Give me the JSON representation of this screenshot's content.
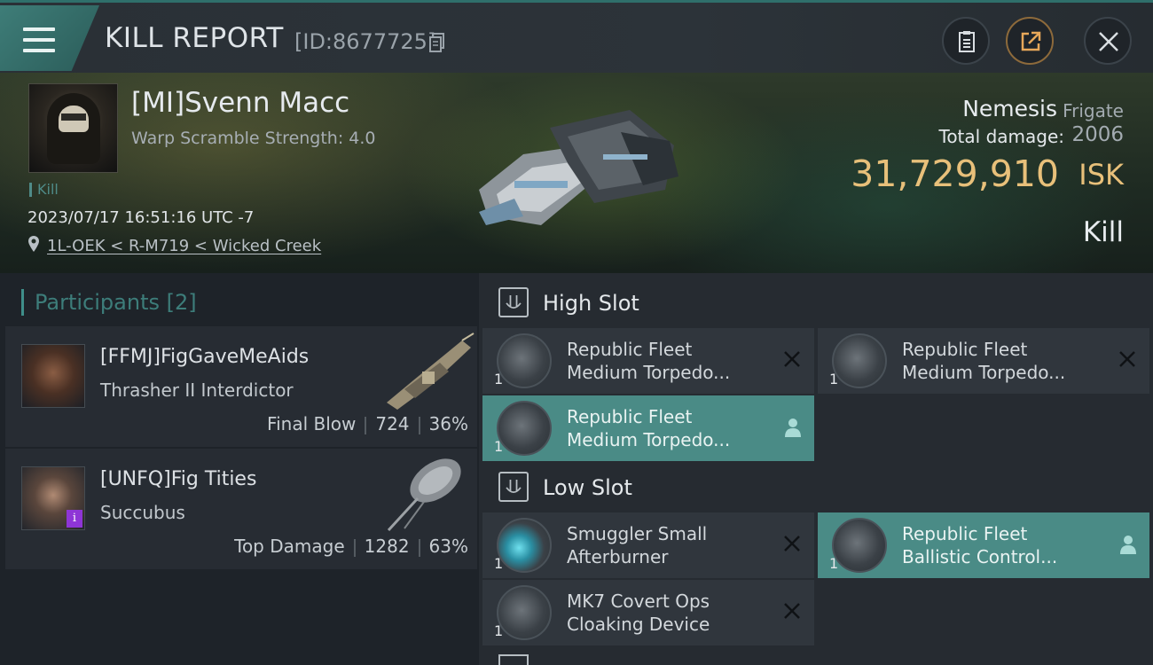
{
  "header": {
    "title": "KILL REPORT",
    "report_id": "[ID:8677725]"
  },
  "victim": {
    "name": "[MI]Svenn Macc",
    "warp_scramble": "Warp Scramble Strength: 4.0",
    "tag": "Kill",
    "datetime": "2023/07/17 16:51:16 UTC -7",
    "location": "1L-OEK < R-M719 < Wicked Creek"
  },
  "ship": {
    "name": "Nemesis",
    "class": "Frigate",
    "total_damage_label": "Total damage:",
    "total_damage": "2006",
    "isk_value": "31,729,910",
    "isk_unit": "ISK",
    "result": "Kill"
  },
  "participants": {
    "header": "Participants [2]",
    "items": [
      {
        "name": "[FFMJ]FigGaveMeAids",
        "ship": "Thrasher II Interdictor",
        "role": "Final Blow",
        "damage": "724",
        "percent": "36%"
      },
      {
        "name": "[UNFQ]Fig Tities",
        "ship": "Succubus",
        "role": "Top Damage",
        "damage": "1282",
        "percent": "63%",
        "badge": "i"
      }
    ]
  },
  "fitting": {
    "high_slot": {
      "title": "High Slot",
      "modules": [
        {
          "line1": "Republic Fleet",
          "line2": "Medium Torpedo...",
          "qty": "1",
          "state": "destroyed"
        },
        {
          "line1": "Republic Fleet",
          "line2": "Medium Torpedo...",
          "qty": "1",
          "state": "destroyed"
        },
        {
          "line1": "Republic Fleet",
          "line2": "Medium Torpedo...",
          "qty": "1",
          "state": "dropped"
        }
      ]
    },
    "low_slot": {
      "title": "Low Slot",
      "modules": [
        {
          "line1": "Smuggler Small",
          "line2": "Afterburner",
          "qty": "1",
          "state": "destroyed"
        },
        {
          "line1": "Republic Fleet",
          "line2": "Ballistic Control...",
          "qty": "1",
          "state": "dropped"
        },
        {
          "line1": "MK7 Covert Ops",
          "line2": "Cloaking Device",
          "qty": "1",
          "state": "destroyed"
        }
      ]
    }
  },
  "colors": {
    "accent_teal": "#4a8b86",
    "isk_gold": "#e8c07a",
    "badge_purple": "#8e35d6"
  },
  "icons": [
    "menu-icon",
    "copy-icon",
    "clipboard-icon",
    "share-icon",
    "close-icon",
    "location-pin-icon",
    "slot-icon",
    "close-x-icon",
    "person-icon"
  ]
}
